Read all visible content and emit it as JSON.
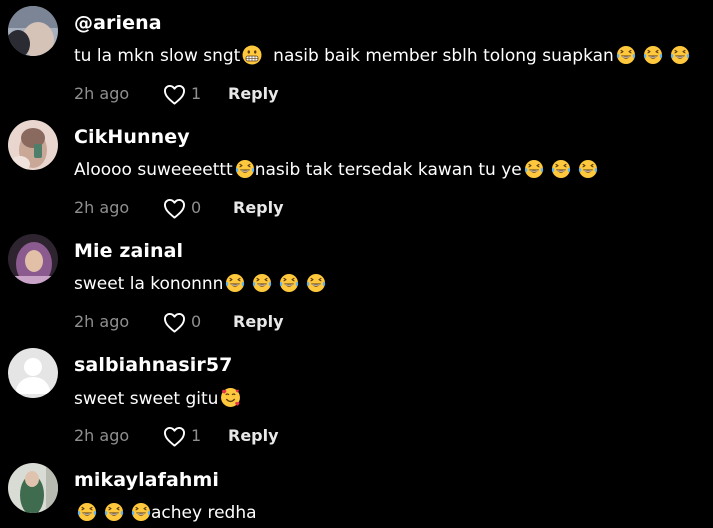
{
  "comments": [
    {
      "username": "@ariena",
      "text_before": "tu la mkn slow sngt",
      "text_after": "  nasib baik member sblh tolong suapkan",
      "time": "2h ago",
      "likes": "1",
      "reply_label": "Reply",
      "emoji_inline": "grimacing-face",
      "emoji_trailing": [
        "laughing-tears",
        "laughing-tears",
        "laughing-tears"
      ]
    },
    {
      "username": "CikHunney",
      "text_before": "Aloooo suweeeettt",
      "text_after": "nasib tak tersedak kawan tu ye",
      "time": "2h ago",
      "likes": "0",
      "reply_label": "Reply",
      "emoji_inline": "laughing-tears",
      "emoji_trailing": [
        "laughing-tears",
        "laughing-tears",
        "laughing-tears"
      ]
    },
    {
      "username": "Mie zainal",
      "text_before": "sweet la kononnn",
      "time": "2h ago",
      "likes": "0",
      "reply_label": "Reply",
      "emoji_trailing": [
        "laughing-tears",
        "laughing-tears",
        "laughing-tears",
        "laughing-tears"
      ]
    },
    {
      "username": "salbiahnasir57",
      "text_before": "sweet sweet gitu",
      "time": "2h ago",
      "likes": "1",
      "reply_label": "Reply",
      "emoji_trailing": [
        "smiling-face-with-hearts"
      ]
    },
    {
      "username": "mikaylafahmi",
      "text_before": "achey redha",
      "emoji_leading": [
        "laughing-tears",
        "laughing-tears",
        "laughing-tears"
      ]
    }
  ],
  "colors": {
    "background": "#000000",
    "username": "#ffffff",
    "text": "#ffffff",
    "meta": "#8f8f8f",
    "reply": "#e8e8e8",
    "emoji": "#ffc83d"
  }
}
